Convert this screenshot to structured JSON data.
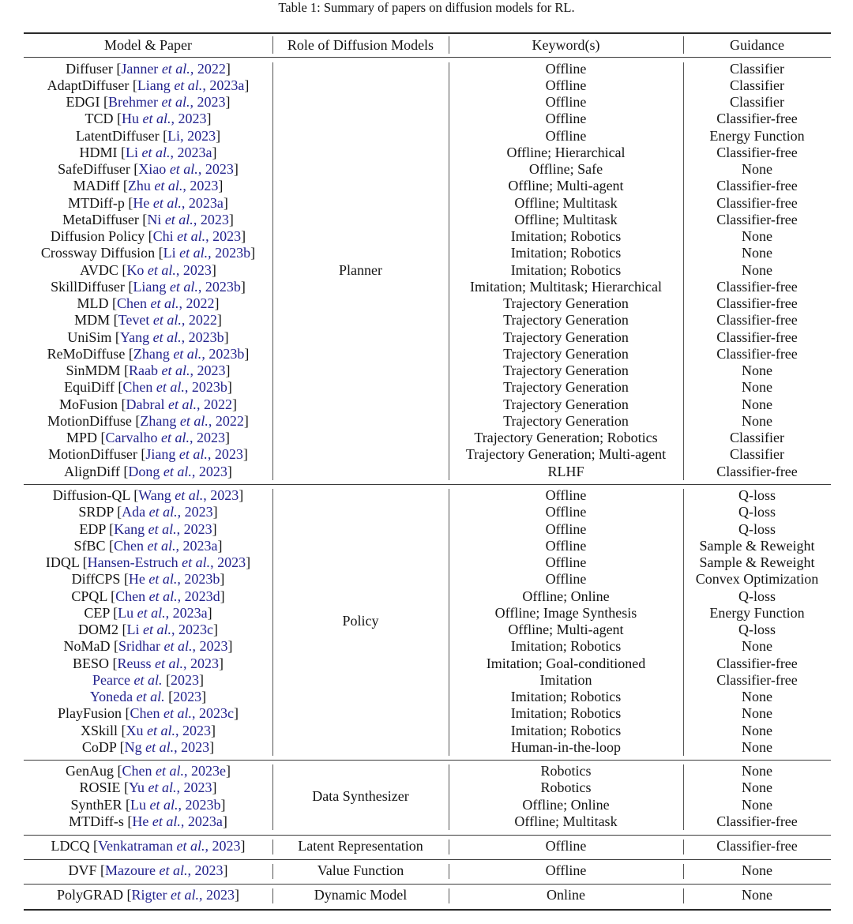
{
  "caption": "Table 1: Summary of papers on diffusion models for RL.",
  "colors": {
    "citation": "#23238e",
    "text": "#141414"
  },
  "header": [
    "Model & Paper",
    "Role of Diffusion Models",
    "Keyword(s)",
    "Guidance"
  ],
  "sections": [
    {
      "role": "Planner",
      "rows": [
        {
          "model": "Diffuser",
          "author": "Janner",
          "year": "2022",
          "keywords": "Offline",
          "guidance": "Classifier"
        },
        {
          "model": "AdaptDiffuser",
          "author": "Liang",
          "year": "2023a",
          "keywords": "Offline",
          "guidance": "Classifier"
        },
        {
          "model": "EDGI",
          "author": "Brehmer",
          "year": "2023",
          "keywords": "Offline",
          "guidance": "Classifier"
        },
        {
          "model": "TCD",
          "author": "Hu",
          "year": "2023",
          "keywords": "Offline",
          "guidance": "Classifier-free"
        },
        {
          "model": "LatentDiffuser",
          "author": "Li",
          "year": "2023",
          "etal": false,
          "keywords": "Offline",
          "guidance": "Energy Function"
        },
        {
          "model": "HDMI",
          "author": "Li",
          "year": "2023a",
          "keywords": "Offline; Hierarchical",
          "guidance": "Classifier-free"
        },
        {
          "model": "SafeDiffuser",
          "author": "Xiao",
          "year": "2023",
          "keywords": "Offline; Safe",
          "guidance": "None"
        },
        {
          "model": "MADiff",
          "author": "Zhu",
          "year": "2023",
          "keywords": "Offline; Multi-agent",
          "guidance": "Classifier-free"
        },
        {
          "model": "MTDiff-p",
          "author": "He",
          "year": "2023a",
          "keywords": "Offline; Multitask",
          "guidance": "Classifier-free"
        },
        {
          "model": "MetaDiffuser",
          "author": "Ni",
          "year": "2023",
          "keywords": "Offline; Multitask",
          "guidance": "Classifier-free"
        },
        {
          "model": "Diffusion Policy",
          "author": "Chi",
          "year": "2023",
          "keywords": "Imitation; Robotics",
          "guidance": "None"
        },
        {
          "model": "Crossway Diffusion",
          "author": "Li",
          "year": "2023b",
          "keywords": "Imitation; Robotics",
          "guidance": "None"
        },
        {
          "model": "AVDC",
          "author": "Ko",
          "year": "2023",
          "keywords": "Imitation; Robotics",
          "guidance": "None"
        },
        {
          "model": "SkillDiffuser",
          "author": "Liang",
          "year": "2023b",
          "keywords": "Imitation; Multitask; Hierarchical",
          "guidance": "Classifier-free"
        },
        {
          "model": "MLD",
          "author": "Chen",
          "year": "2022",
          "keywords": "Trajectory Generation",
          "guidance": "Classifier-free"
        },
        {
          "model": "MDM",
          "author": "Tevet",
          "year": "2022",
          "keywords": "Trajectory Generation",
          "guidance": "Classifier-free"
        },
        {
          "model": "UniSim",
          "author": "Yang",
          "year": "2023b",
          "keywords": "Trajectory Generation",
          "guidance": "Classifier-free"
        },
        {
          "model": "ReMoDiffuse",
          "author": "Zhang",
          "year": "2023b",
          "keywords": "Trajectory Generation",
          "guidance": "Classifier-free"
        },
        {
          "model": "SinMDM",
          "author": "Raab",
          "year": "2023",
          "keywords": "Trajectory Generation",
          "guidance": "None"
        },
        {
          "model": "EquiDiff",
          "author": "Chen",
          "year": "2023b",
          "keywords": "Trajectory Generation",
          "guidance": "None"
        },
        {
          "model": "MoFusion",
          "author": "Dabral",
          "year": "2022",
          "keywords": "Trajectory Generation",
          "guidance": "None"
        },
        {
          "model": "MotionDiffuse",
          "author": "Zhang",
          "year": "2022",
          "keywords": "Trajectory Generation",
          "guidance": "None"
        },
        {
          "model": "MPD",
          "author": "Carvalho",
          "year": "2023",
          "keywords": "Trajectory Generation; Robotics",
          "guidance": "Classifier"
        },
        {
          "model": "MotionDiffuser",
          "author": "Jiang",
          "year": "2023",
          "keywords": "Trajectory Generation; Multi-agent",
          "guidance": "Classifier"
        },
        {
          "model": "AlignDiff",
          "author": "Dong",
          "year": "2023",
          "keywords": "RLHF",
          "guidance": "Classifier-free"
        }
      ]
    },
    {
      "role": "Policy",
      "rows": [
        {
          "model": "Diffusion-QL",
          "author": "Wang",
          "year": "2023",
          "keywords": "Offline",
          "guidance": "Q-loss"
        },
        {
          "model": "SRDP",
          "author": "Ada",
          "year": "2023",
          "keywords": "Offline",
          "guidance": "Q-loss"
        },
        {
          "model": "EDP",
          "author": "Kang",
          "year": "2023",
          "keywords": "Offline",
          "guidance": "Q-loss"
        },
        {
          "model": "SfBC",
          "author": "Chen",
          "year": "2023a",
          "keywords": "Offline",
          "guidance": "Sample & Reweight"
        },
        {
          "model": "IDQL",
          "author": "Hansen-Estruch",
          "year": "2023",
          "keywords": "Offline",
          "guidance": "Sample & Reweight"
        },
        {
          "model": "DiffCPS",
          "author": "He",
          "year": "2023b",
          "keywords": "Offline",
          "guidance": "Convex Optimization"
        },
        {
          "model": "CPQL",
          "author": "Chen",
          "year": "2023d",
          "keywords": "Offline; Online",
          "guidance": "Q-loss"
        },
        {
          "model": "CEP",
          "author": "Lu",
          "year": "2023a",
          "keywords": "Offline; Image Synthesis",
          "guidance": "Energy Function"
        },
        {
          "model": "DOM2",
          "author": "Li",
          "year": "2023c",
          "keywords": "Offline; Multi-agent",
          "guidance": "Q-loss"
        },
        {
          "model": "NoMaD",
          "author": "Sridhar",
          "year": "2023",
          "keywords": "Imitation; Robotics",
          "guidance": "None"
        },
        {
          "model": "BESO",
          "author": "Reuss",
          "year": "2023",
          "keywords": "Imitation; Goal-conditioned",
          "guidance": "Classifier-free"
        },
        {
          "model": "",
          "author": "Pearce",
          "year": "2023",
          "textual": true,
          "keywords": "Imitation",
          "guidance": "Classifier-free"
        },
        {
          "model": "",
          "author": "Yoneda",
          "year": "2023",
          "textual": true,
          "keywords": "Imitation; Robotics",
          "guidance": "None"
        },
        {
          "model": "PlayFusion",
          "author": "Chen",
          "year": "2023c",
          "keywords": "Imitation; Robotics",
          "guidance": "None"
        },
        {
          "model": "XSkill",
          "author": "Xu",
          "year": "2023",
          "keywords": "Imitation; Robotics",
          "guidance": "None"
        },
        {
          "model": "CoDP",
          "author": "Ng",
          "year": "2023",
          "keywords": "Human-in-the-loop",
          "guidance": "None"
        }
      ]
    },
    {
      "role": "Data Synthesizer",
      "rows": [
        {
          "model": "GenAug",
          "author": "Chen",
          "year": "2023e",
          "keywords": "Robotics",
          "guidance": "None"
        },
        {
          "model": "ROSIE",
          "author": "Yu",
          "year": "2023",
          "keywords": "Robotics",
          "guidance": "None"
        },
        {
          "model": "SynthER",
          "author": "Lu",
          "year": "2023b",
          "keywords": "Offline; Online",
          "guidance": "None"
        },
        {
          "model": "MTDiff-s",
          "author": "He",
          "year": "2023a",
          "keywords": "Offline; Multitask",
          "guidance": "Classifier-free"
        }
      ]
    },
    {
      "role": "Latent Representation",
      "rows": [
        {
          "model": "LDCQ",
          "author": "Venkatraman",
          "year": "2023",
          "keywords": "Offline",
          "guidance": "Classifier-free"
        }
      ]
    },
    {
      "role": "Value Function",
      "rows": [
        {
          "model": "DVF",
          "author": "Mazoure",
          "year": "2023",
          "keywords": "Offline",
          "guidance": "None"
        }
      ]
    },
    {
      "role": "Dynamic Model",
      "rows": [
        {
          "model": "PolyGRAD",
          "author": "Rigter",
          "year": "2023",
          "keywords": "Online",
          "guidance": "None"
        }
      ]
    }
  ],
  "etal_text": "et al."
}
